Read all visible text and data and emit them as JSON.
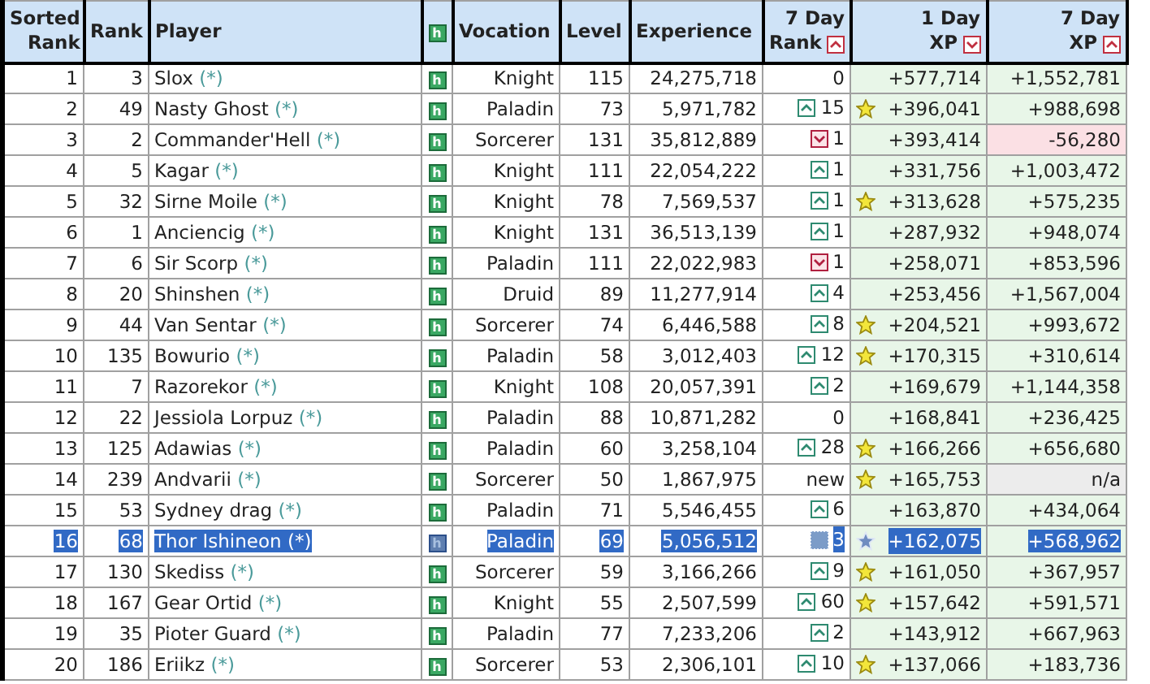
{
  "table": {
    "columns": [
      {
        "lines": [
          "Sorted",
          "Rank"
        ]
      },
      {
        "lines": [
          "Rank"
        ]
      },
      {
        "lines": [
          "Player"
        ]
      },
      {
        "lines": [
          "h"
        ],
        "kind": "icon"
      },
      {
        "lines": [
          "Vocation"
        ]
      },
      {
        "lines": [
          "Level"
        ]
      },
      {
        "lines": [
          "Experience"
        ]
      },
      {
        "lines": [
          "7 Day",
          "Rank"
        ],
        "sort_descending": false
      },
      {
        "lines": [
          "1 Day",
          "XP"
        ],
        "sort_descending": true
      },
      {
        "lines": [
          "7 Day",
          "XP"
        ],
        "sort_descending": false
      }
    ],
    "rows": [
      {
        "sorted": "1",
        "rank": "3",
        "player": "Slox",
        "link": "(*)",
        "h": "h",
        "vocation": "Knight",
        "level": "115",
        "experience": "24,275,718",
        "change": {
          "kind": "none",
          "text": "0"
        },
        "star": false,
        "xp1": "+577,714",
        "xp7": {
          "kind": "gain",
          "text": "+1,552,781"
        },
        "selected": false
      },
      {
        "sorted": "2",
        "rank": "49",
        "player": "Nasty Ghost",
        "link": "(*)",
        "h": "h",
        "vocation": "Paladin",
        "level": "73",
        "experience": "5,971,782",
        "change": {
          "kind": "up",
          "text": "15"
        },
        "star": true,
        "xp1": "+396,041",
        "xp7": {
          "kind": "gain",
          "text": "+988,698"
        },
        "selected": false
      },
      {
        "sorted": "3",
        "rank": "2",
        "player": "Commander'Hell",
        "link": "(*)",
        "h": "h",
        "vocation": "Sorcerer",
        "level": "131",
        "experience": "35,812,889",
        "change": {
          "kind": "down",
          "text": "1"
        },
        "star": false,
        "xp1": "+393,414",
        "xp7": {
          "kind": "loss",
          "text": "-56,280"
        },
        "selected": false
      },
      {
        "sorted": "4",
        "rank": "5",
        "player": "Kagar",
        "link": "(*)",
        "h": "h",
        "vocation": "Knight",
        "level": "111",
        "experience": "22,054,222",
        "change": {
          "kind": "up",
          "text": "1"
        },
        "star": false,
        "xp1": "+331,756",
        "xp7": {
          "kind": "gain",
          "text": "+1,003,472"
        },
        "selected": false
      },
      {
        "sorted": "5",
        "rank": "32",
        "player": "Sirne Moile",
        "link": "(*)",
        "h": "h",
        "vocation": "Knight",
        "level": "78",
        "experience": "7,569,537",
        "change": {
          "kind": "up",
          "text": "1"
        },
        "star": true,
        "xp1": "+313,628",
        "xp7": {
          "kind": "gain",
          "text": "+575,235"
        },
        "selected": false
      },
      {
        "sorted": "6",
        "rank": "1",
        "player": "Anciencig",
        "link": "(*)",
        "h": "h",
        "vocation": "Knight",
        "level": "131",
        "experience": "36,513,139",
        "change": {
          "kind": "up",
          "text": "1"
        },
        "star": false,
        "xp1": "+287,932",
        "xp7": {
          "kind": "gain",
          "text": "+948,074"
        },
        "selected": false
      },
      {
        "sorted": "7",
        "rank": "6",
        "player": "Sir Scorp",
        "link": "(*)",
        "h": "h",
        "vocation": "Paladin",
        "level": "111",
        "experience": "22,022,983",
        "change": {
          "kind": "down",
          "text": "1"
        },
        "star": false,
        "xp1": "+258,071",
        "xp7": {
          "kind": "gain",
          "text": "+853,596"
        },
        "selected": false
      },
      {
        "sorted": "8",
        "rank": "20",
        "player": "Shinshen",
        "link": "(*)",
        "h": "h",
        "vocation": "Druid",
        "level": "89",
        "experience": "11,277,914",
        "change": {
          "kind": "up",
          "text": "4"
        },
        "star": false,
        "xp1": "+253,456",
        "xp7": {
          "kind": "gain",
          "text": "+1,567,004"
        },
        "selected": false
      },
      {
        "sorted": "9",
        "rank": "44",
        "player": "Van Sentar",
        "link": "(*)",
        "h": "h",
        "vocation": "Sorcerer",
        "level": "74",
        "experience": "6,446,588",
        "change": {
          "kind": "up",
          "text": "8"
        },
        "star": true,
        "xp1": "+204,521",
        "xp7": {
          "kind": "gain",
          "text": "+993,672"
        },
        "selected": false
      },
      {
        "sorted": "10",
        "rank": "135",
        "player": "Bowurio",
        "link": "(*)",
        "h": "h",
        "vocation": "Paladin",
        "level": "58",
        "experience": "3,012,403",
        "change": {
          "kind": "up",
          "text": "12"
        },
        "star": true,
        "xp1": "+170,315",
        "xp7": {
          "kind": "gain",
          "text": "+310,614"
        },
        "selected": false
      },
      {
        "sorted": "11",
        "rank": "7",
        "player": "Razorekor",
        "link": "(*)",
        "h": "h",
        "vocation": "Knight",
        "level": "108",
        "experience": "20,057,391",
        "change": {
          "kind": "up",
          "text": "2"
        },
        "star": false,
        "xp1": "+169,679",
        "xp7": {
          "kind": "gain",
          "text": "+1,144,358"
        },
        "selected": false
      },
      {
        "sorted": "12",
        "rank": "22",
        "player": "Jessiola Lorpuz",
        "link": "(*)",
        "h": "h",
        "vocation": "Paladin",
        "level": "88",
        "experience": "10,871,282",
        "change": {
          "kind": "none",
          "text": "0"
        },
        "star": false,
        "xp1": "+168,841",
        "xp7": {
          "kind": "gain",
          "text": "+236,425"
        },
        "selected": false
      },
      {
        "sorted": "13",
        "rank": "125",
        "player": "Adawias",
        "link": "(*)",
        "h": "h",
        "vocation": "Paladin",
        "level": "60",
        "experience": "3,258,104",
        "change": {
          "kind": "up",
          "text": "28"
        },
        "star": true,
        "xp1": "+166,266",
        "xp7": {
          "kind": "gain",
          "text": "+656,680"
        },
        "selected": false
      },
      {
        "sorted": "14",
        "rank": "239",
        "player": "Andvarii",
        "link": "(*)",
        "h": "h",
        "vocation": "Sorcerer",
        "level": "50",
        "experience": "1,867,975",
        "change": {
          "kind": "none",
          "text": "new"
        },
        "star": true,
        "xp1": "+165,753",
        "xp7": {
          "kind": "na",
          "text": "n/a"
        },
        "selected": false
      },
      {
        "sorted": "15",
        "rank": "53",
        "player": "Sydney drag",
        "link": "(*)",
        "h": "h",
        "vocation": "Paladin",
        "level": "71",
        "experience": "5,546,455",
        "change": {
          "kind": "up",
          "text": "6"
        },
        "star": false,
        "xp1": "+163,870",
        "xp7": {
          "kind": "gain",
          "text": "+434,064"
        },
        "selected": false
      },
      {
        "sorted": "16",
        "rank": "68",
        "player": "Thor Ishineon",
        "link": "(*)",
        "h": "h",
        "vocation": "Paladin",
        "level": "69",
        "experience": "5,056,512",
        "change": {
          "kind": "up",
          "text": "3"
        },
        "star": true,
        "xp1": "+162,075",
        "xp7": {
          "kind": "gain",
          "text": "+568,962"
        },
        "selected": true
      },
      {
        "sorted": "17",
        "rank": "130",
        "player": "Skediss",
        "link": "(*)",
        "h": "h",
        "vocation": "Sorcerer",
        "level": "59",
        "experience": "3,166,266",
        "change": {
          "kind": "up",
          "text": "9"
        },
        "star": true,
        "xp1": "+161,050",
        "xp7": {
          "kind": "gain",
          "text": "+367,957"
        },
        "selected": false
      },
      {
        "sorted": "18",
        "rank": "167",
        "player": "Gear Ortid",
        "link": "(*)",
        "h": "h",
        "vocation": "Knight",
        "level": "55",
        "experience": "2,507,599",
        "change": {
          "kind": "up",
          "text": "60"
        },
        "star": true,
        "xp1": "+157,642",
        "xp7": {
          "kind": "gain",
          "text": "+591,571"
        },
        "selected": false
      },
      {
        "sorted": "19",
        "rank": "35",
        "player": "Pioter Guard",
        "link": "(*)",
        "h": "h",
        "vocation": "Paladin",
        "level": "77",
        "experience": "7,233,206",
        "change": {
          "kind": "up",
          "text": "2"
        },
        "star": false,
        "xp1": "+143,912",
        "xp7": {
          "kind": "gain",
          "text": "+667,963"
        },
        "selected": false
      },
      {
        "sorted": "20",
        "rank": "186",
        "player": "Eriikz",
        "link": "(*)",
        "h": "h",
        "vocation": "Sorcerer",
        "level": "53",
        "experience": "2,306,101",
        "change": {
          "kind": "up",
          "text": "10"
        },
        "star": true,
        "xp1": "+137,066",
        "xp7": {
          "kind": "gain",
          "text": "+183,736"
        },
        "selected": false
      }
    ]
  }
}
